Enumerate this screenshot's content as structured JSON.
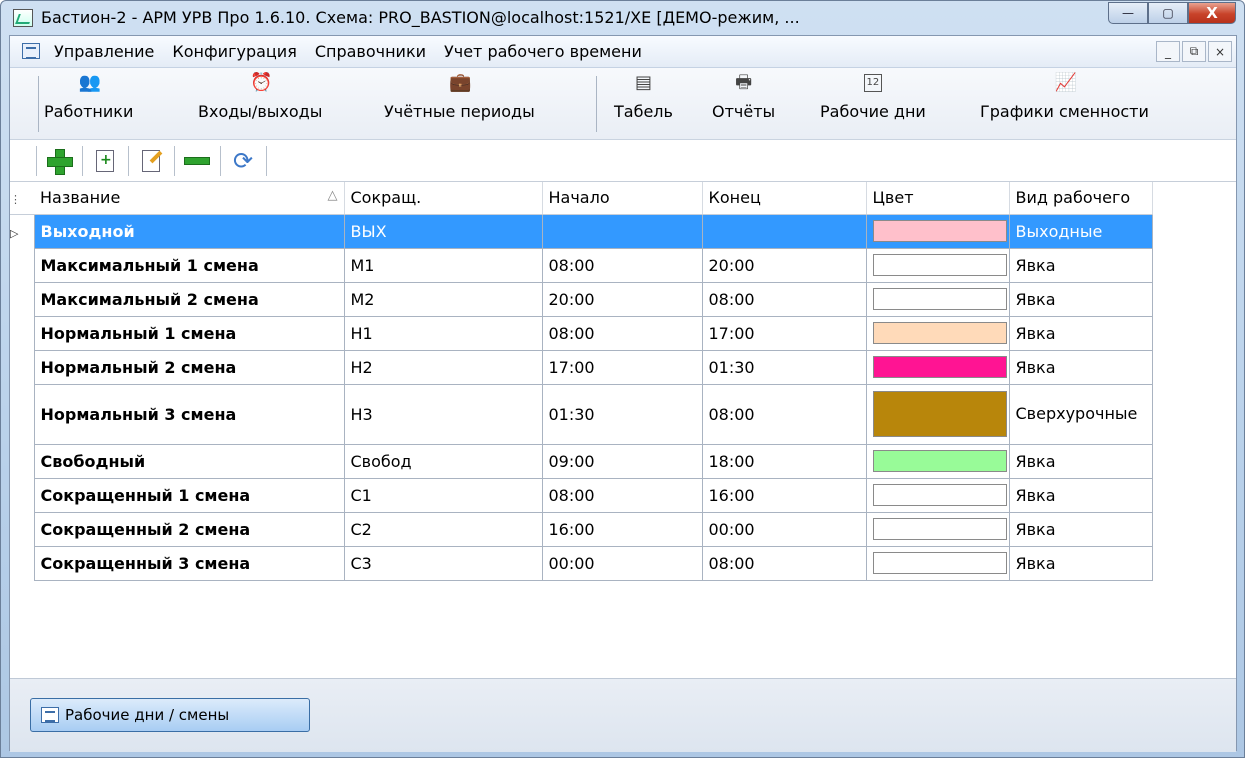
{
  "window": {
    "title": "Бастион-2 - АРМ УРВ Про 1.6.10. Схема: PRO_BASTION@localhost:1521/XE [ДЕМО-режим, ...",
    "close_symbol": "X",
    "minimize_symbol": "—",
    "maximize_symbol": "▢"
  },
  "menu": {
    "items": [
      "Управление",
      "Конфигурация",
      "Справочники",
      "Учет рабочего времени"
    ],
    "mdi_minimize": "_",
    "mdi_restore": "⧉",
    "mdi_close": "×"
  },
  "toolbar": {
    "buttons": [
      {
        "label": "Работники",
        "icon": "users-icon",
        "glyph": "👥"
      },
      {
        "label": "Входы/выходы",
        "icon": "alarm-clock-icon",
        "glyph": "⏰"
      },
      {
        "label": "Учётные периоды",
        "icon": "briefcase-icon",
        "glyph": "💼"
      },
      {
        "label": "Табель",
        "icon": "timesheet-icon",
        "glyph": "▤"
      },
      {
        "label": "Отчёты",
        "icon": "printer-icon",
        "glyph": "🖶"
      },
      {
        "label": "Рабочие дни",
        "icon": "calendar-icon",
        "glyph": "12"
      },
      {
        "label": "Графики сменности",
        "icon": "chart-icon",
        "glyph": "📈"
      }
    ]
  },
  "grid": {
    "sort_indicator": "△",
    "columns": [
      "Название",
      "Сокращ.",
      "Начало",
      "Конец",
      "Цвет",
      "Вид рабочего"
    ],
    "rows": [
      {
        "name": "Выходной",
        "short": "ВЫХ",
        "start": "",
        "end": "",
        "color": "#ffc0cb",
        "type": "Выходные"
      },
      {
        "name": "Максимальный 1 смена",
        "short": "М1",
        "start": "08:00",
        "end": "20:00",
        "color": "#ffffff",
        "type": "Явка"
      },
      {
        "name": "Максимальный 2 смена",
        "short": "М2",
        "start": "20:00",
        "end": "08:00",
        "color": "#ffffff",
        "type": "Явка"
      },
      {
        "name": "Нормальный 1 смена",
        "short": "Н1",
        "start": "08:00",
        "end": "17:00",
        "color": "#ffdab9",
        "type": "Явка"
      },
      {
        "name": "Нормальный 2 смена",
        "short": "Н2",
        "start": "17:00",
        "end": "01:30",
        "color": "#ff1493",
        "type": "Явка"
      },
      {
        "name": "Нормальный 3 смена",
        "short": "Н3",
        "start": "01:30",
        "end": "08:00",
        "color": "#b8860b",
        "type": "Сверхурочные"
      },
      {
        "name": "Свободный",
        "short": "Свобод",
        "start": "09:00",
        "end": "18:00",
        "color": "#98fb98",
        "type": "Явка"
      },
      {
        "name": "Сокращенный 1 смена",
        "short": "С1",
        "start": "08:00",
        "end": "16:00",
        "color": "#ffffff",
        "type": "Явка"
      },
      {
        "name": "Сокращенный 2 смена",
        "short": "С2",
        "start": "16:00",
        "end": "00:00",
        "color": "#ffffff",
        "type": "Явка"
      },
      {
        "name": "Сокращенный 3 смена",
        "short": "С3",
        "start": "00:00",
        "end": "08:00",
        "color": "#ffffff",
        "type": "Явка"
      }
    ],
    "selected_index": 0
  },
  "taskbar": {
    "window_button": "Рабочие дни / смены"
  }
}
